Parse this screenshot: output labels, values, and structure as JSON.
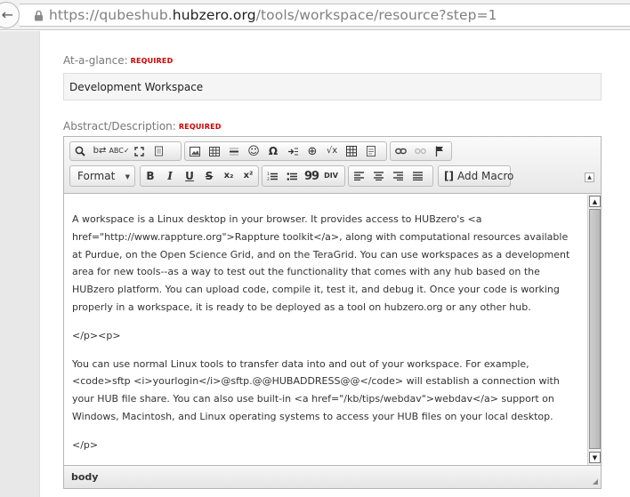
{
  "browser": {
    "url_prefix": "https://",
    "url_domain_a": "qubeshub.",
    "url_domain_b": "hubzero.org",
    "url_path": "/tools/workspace/resource?step=1"
  },
  "form": {
    "glance": {
      "label": "At-a-glance:",
      "required": "REQUIRED",
      "value": "Development Workspace"
    },
    "abstract": {
      "label": "Abstract/Description:",
      "required": "REQUIRED"
    }
  },
  "editor": {
    "format_label": "Format",
    "add_macro_label": "Add Macro",
    "bold_label": "B",
    "italic_label": "I",
    "underline_label": "U",
    "strike_label": "S",
    "subscript_label": "x₂",
    "superscript_label": "x²",
    "quote_label": "99",
    "content": [
      "A workspace is a Linux desktop in your browser. It provides access to HUBzero's <a href=\"http://www.rappture.org\">Rappture toolkit</a>, along with computational resources available at Purdue, on the Open Science Grid, and on the TeraGrid. You can use workspaces as a development area for new tools--as a way to test out the functionality that comes with any hub based on the HUBzero platform.  You can upload code, compile it, test it, and debug it. Once your code is working properly in a workspace, it is ready to be deployed as a tool on hubzero.org or any other hub.",
      "</p><p>",
      "You can use normal Linux tools to transfer data into and out of your workspace.  For example, <code>sftp <i>yourlogin</i>@sftp.@@HUBADDRESS@@</code> will establish a connection with your HUB file share.  You can also use built-in <a href=\"/kb/tips/webdav\">webdav</a> support on Windows, Macintosh, and Linux operating systems to access your HUB files on your local desktop.",
      "</p>"
    ],
    "status_path": "body"
  },
  "colors": {
    "required": "#cc0000",
    "field_bg": "#f5f5f5",
    "page_bg": "#e8e8e8"
  }
}
